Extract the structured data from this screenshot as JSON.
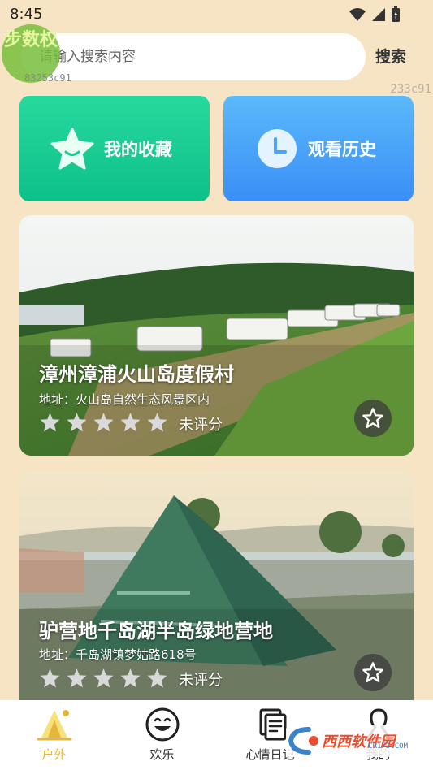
{
  "status": {
    "time": "8:45"
  },
  "watermark": {
    "logo_text": "步数权",
    "code_left": "83253c91",
    "code_right": "233c91",
    "brand": "西西软件园",
    "brand_sub": "CR173.COM"
  },
  "search": {
    "placeholder": "请输入搜索内容",
    "button_label": "搜索"
  },
  "quick_actions": [
    {
      "label": "我的收藏",
      "icon": "star-icon",
      "color": "#17cc92"
    },
    {
      "label": "观看历史",
      "icon": "clock-icon",
      "color": "#4aa3f8"
    }
  ],
  "cards": [
    {
      "title": "漳州漳浦火山岛度假村",
      "address": "地址：火山岛自然生态风景区内",
      "rating_text": "未评分",
      "stars": 0,
      "favorited": false
    },
    {
      "title": "驴营地千岛湖半岛绿地营地",
      "address": "地址：千岛湖镇梦姑路618号",
      "rating_text": "未评分",
      "stars": 0,
      "favorited": false
    }
  ],
  "tabs": [
    {
      "label": "户外",
      "icon": "tent-icon",
      "active": true
    },
    {
      "label": "欢乐",
      "icon": "smile-icon",
      "active": false
    },
    {
      "label": "心情日记",
      "icon": "notes-icon",
      "active": false
    },
    {
      "label": "我的",
      "icon": "person-icon",
      "active": false
    }
  ],
  "colors": {
    "background": "#f7e4c4",
    "tab_active": "#e6b63a",
    "fav_green": "#17cc92",
    "history_blue": "#4aa3f8"
  }
}
